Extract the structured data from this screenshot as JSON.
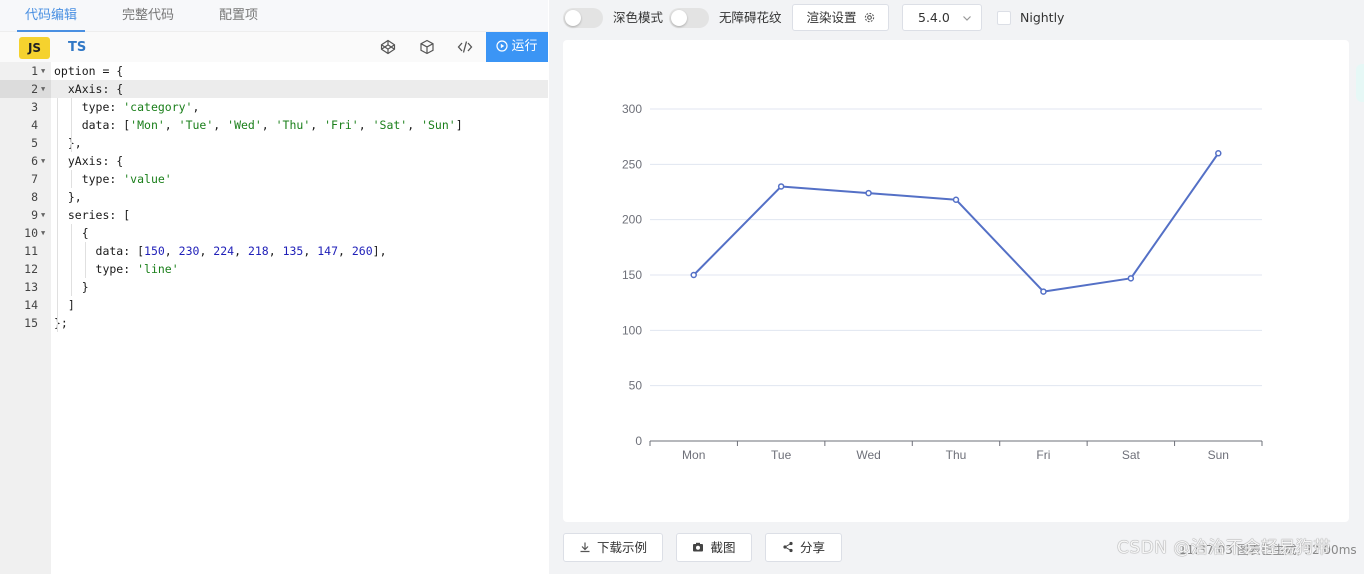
{
  "tabs": [
    {
      "label": "代码编辑",
      "active": true
    },
    {
      "label": "完整代码",
      "active": false
    },
    {
      "label": "配置项",
      "active": false
    }
  ],
  "langbar": {
    "js_label": "JS",
    "ts_label": "TS",
    "icons": [
      "codepen-icon",
      "box-icon",
      "code-icon"
    ],
    "run_label": "运行"
  },
  "editor": {
    "lines": [
      "option = {",
      "  xAxis: {",
      "    type: 'category',",
      "    data: ['Mon', 'Tue', 'Wed', 'Thu', 'Fri', 'Sat', 'Sun']",
      "  },",
      "  yAxis: {",
      "    type: 'value'",
      "  },",
      "  series: [",
      "    {",
      "      data: [150, 230, 224, 218, 135, 147, 260],",
      "      type: 'line'",
      "    }",
      "  ]",
      "};"
    ],
    "line_numbers": [
      "1",
      "2",
      "3",
      "4",
      "5",
      "6",
      "7",
      "8",
      "9",
      "10",
      "11",
      "12",
      "13",
      "14",
      "15"
    ],
    "foldable": [
      1,
      2,
      6,
      9,
      10
    ],
    "active_line": 2
  },
  "topbar": {
    "dark_mode_label": "深色模式",
    "dark_mode_on": false,
    "accessible_label": "无障碍花纹",
    "accessible_on": false,
    "render_settings_label": "渲染设置",
    "version": "5.4.0",
    "nightly_label": "Nightly",
    "nightly_checked": false
  },
  "chart_data": {
    "type": "line",
    "categories": [
      "Mon",
      "Tue",
      "Wed",
      "Thu",
      "Fri",
      "Sat",
      "Sun"
    ],
    "series": [
      {
        "values": [
          150,
          230,
          224,
          218,
          135,
          147,
          260
        ],
        "color": "#5470c6"
      }
    ],
    "yticks": [
      0,
      50,
      100,
      150,
      200,
      250,
      300
    ],
    "ylim": [
      0,
      300
    ],
    "title": "",
    "xlabel": "",
    "ylabel": "",
    "grid": true
  },
  "bottombar": {
    "download_label": "下载示例",
    "screenshot_label": "截图",
    "share_label": "分享",
    "status_text": "11:37:03  图表已生成, 32.00ms",
    "watermark": "CSDN @治治不会轻易狗带"
  },
  "colors": {
    "accent": "#3b95f5",
    "series": "#5470c6",
    "js_badge": "#f5d22e",
    "ts_text": "#3178c6"
  }
}
